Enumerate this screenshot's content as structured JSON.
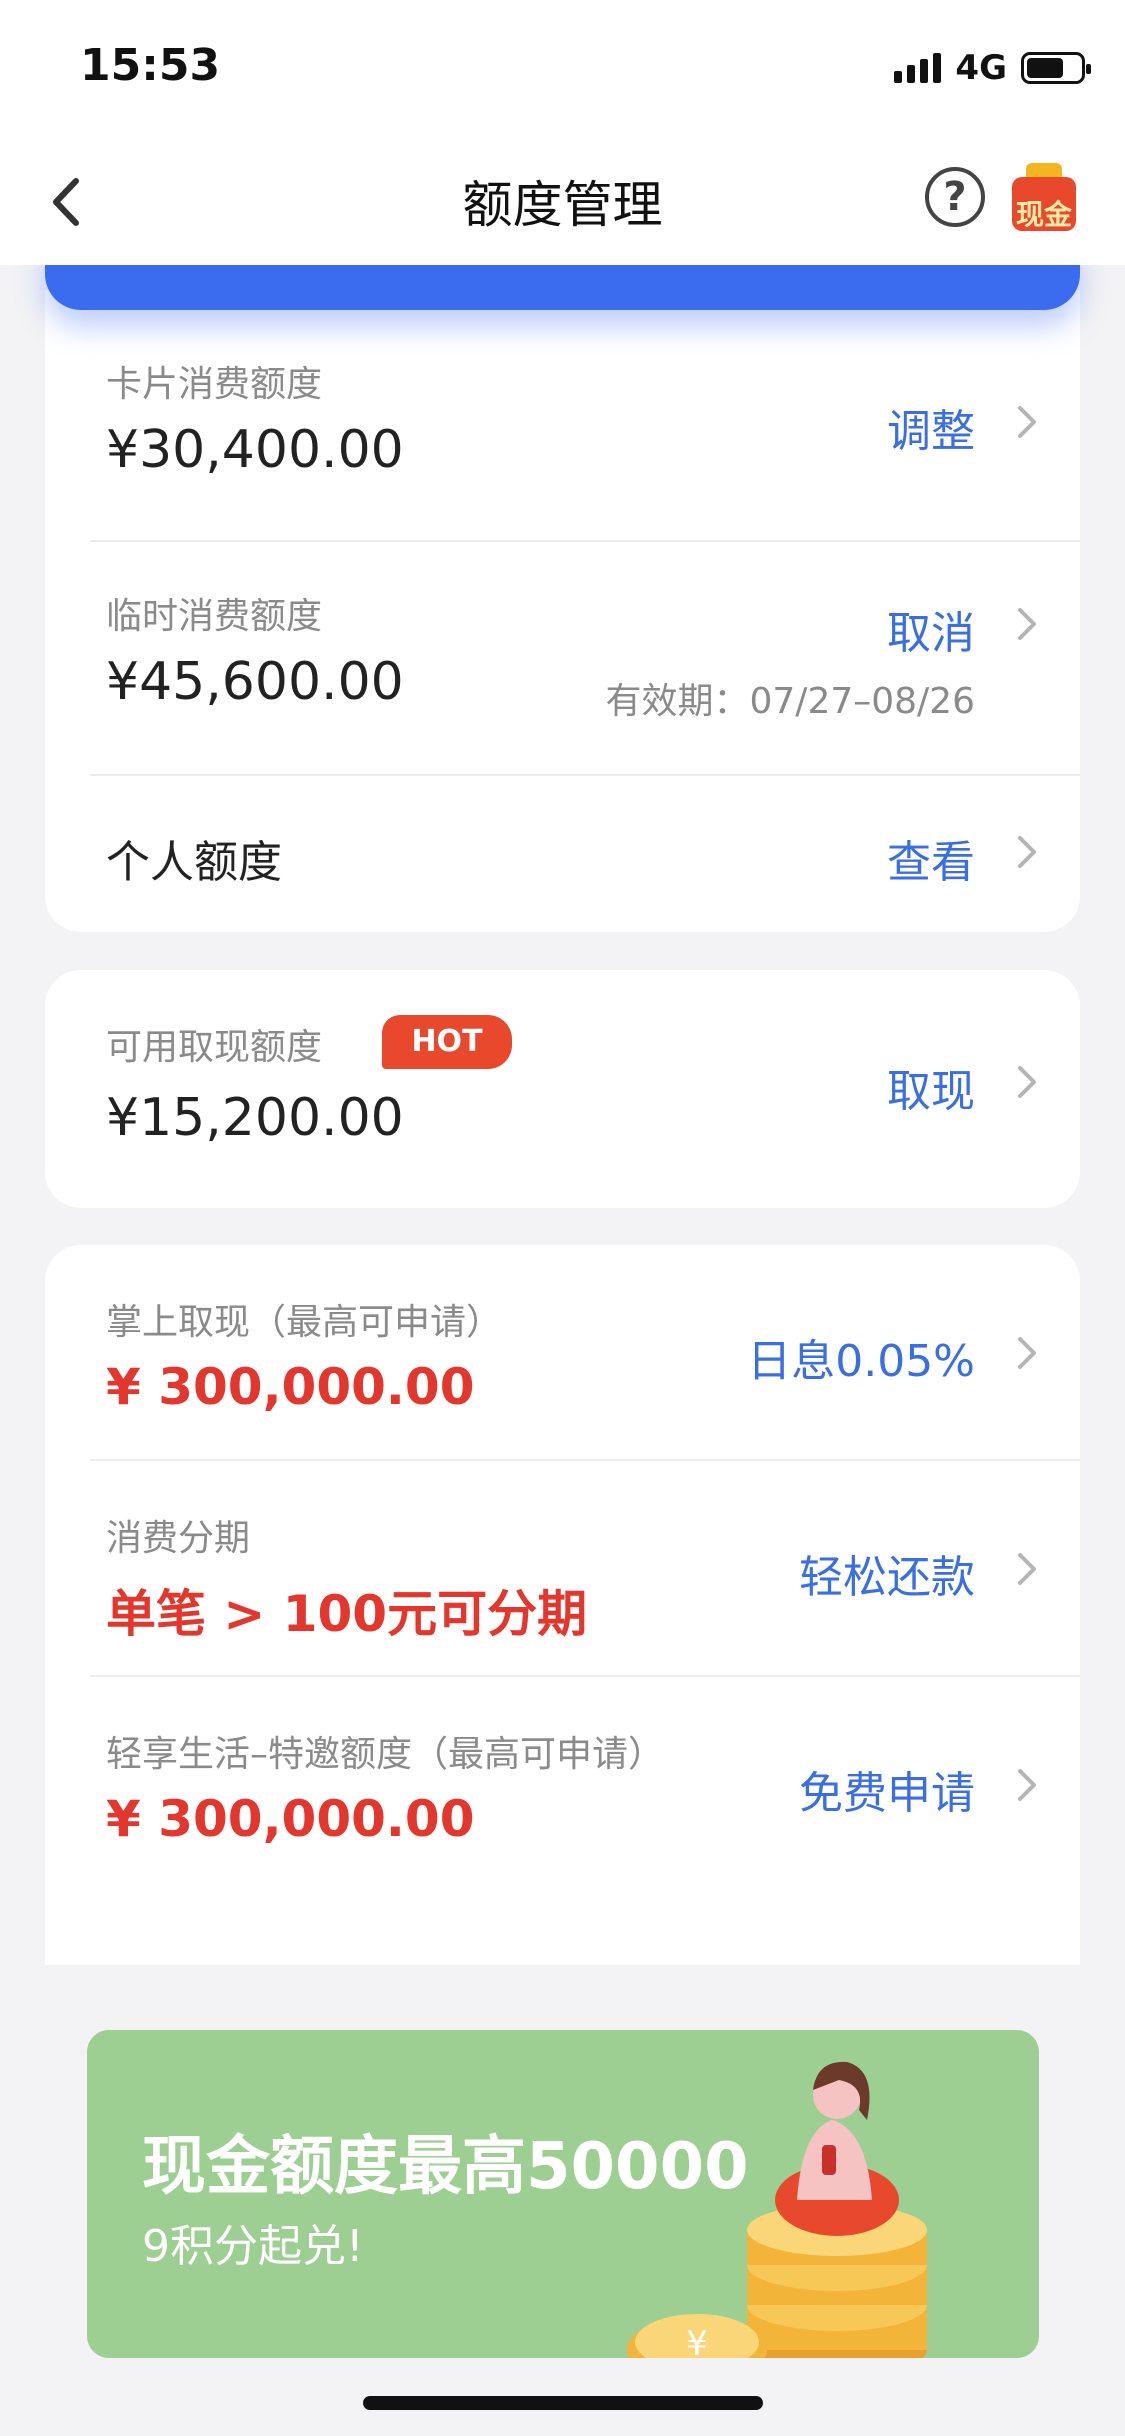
{
  "status_bar": {
    "time": "15:53",
    "network": "4G",
    "battery_level": 0.7
  },
  "nav": {
    "title": "额度管理",
    "help_icon": "question-circle-icon",
    "cash_label": "现金"
  },
  "card_limits": {
    "consumption": {
      "label": "卡片消费额度",
      "amount": "¥30,400.00",
      "action": "调整"
    },
    "temporary": {
      "label": "临时消费额度",
      "amount": "¥45,600.00",
      "action": "取消",
      "validity": "有效期：07/27–08/26"
    },
    "personal": {
      "label": "个人额度",
      "action": "查看"
    }
  },
  "cash_limit": {
    "label": "可用取现额度",
    "badge": "HOT",
    "amount": "¥15,200.00",
    "action": "取现"
  },
  "products": [
    {
      "label": "掌上取现（最高可申请）",
      "value": "¥ 300,000.00",
      "action": "日息0.05%"
    },
    {
      "label": "消费分期",
      "value": "单笔 > 100元可分期",
      "action": "轻松还款"
    },
    {
      "label": "轻享生活–特邀额度（最高可申请）",
      "value": "¥ 300,000.00",
      "action": "免费申请"
    }
  ],
  "promo": {
    "title": "现金额度最高50000",
    "subtitle": "9积分起兑!",
    "coin_symbol": "¥"
  },
  "colors": {
    "accent_blue": "#3a6fe3",
    "red": "#e3362c",
    "banner_blue": "#3b6cf0",
    "promo_green": "#9dce92"
  }
}
